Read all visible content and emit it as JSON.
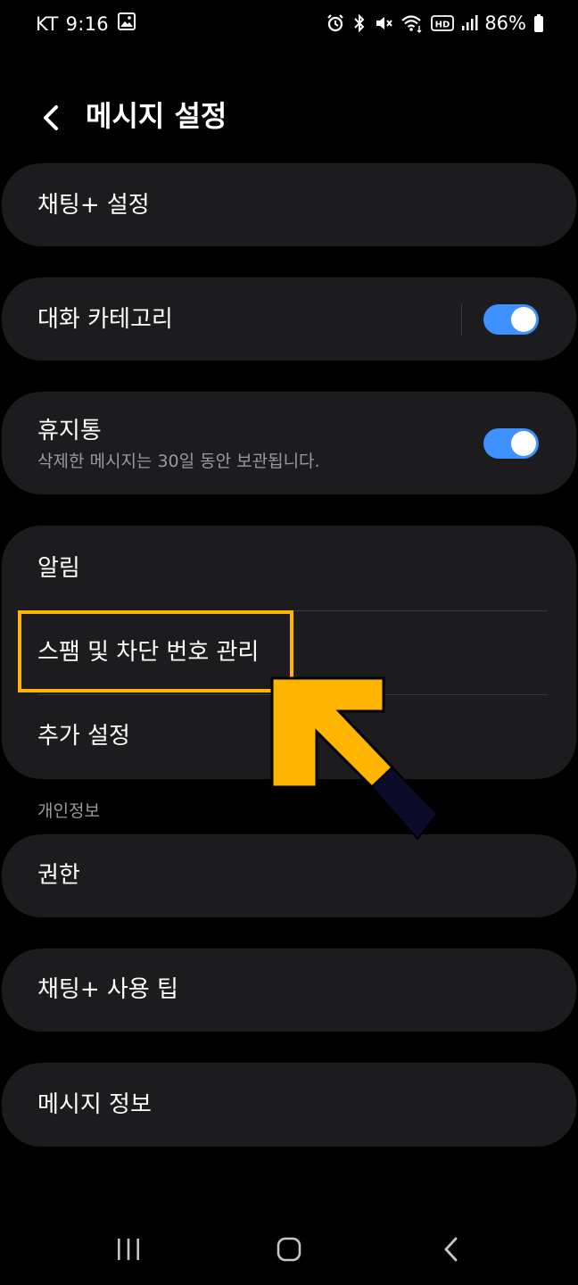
{
  "status_bar": {
    "carrier": "KT",
    "time": "9:16",
    "battery": "86%",
    "icons": [
      "gallery-icon",
      "alarm-icon",
      "bluetooth-icon",
      "mute-icon",
      "wifi-icon",
      "hd-icon",
      "signal-icon",
      "battery-icon"
    ]
  },
  "header": {
    "title": "메시지 설정",
    "back_icon": "chevron-left-icon"
  },
  "settings": {
    "chat_plus_settings": "채팅+ 설정",
    "conversation_categories": {
      "label": "대화 카테고리",
      "enabled": true
    },
    "trash": {
      "label": "휴지통",
      "subtitle": "삭제한 메시지는 30일 동안 보관됩니다.",
      "enabled": true
    },
    "notifications": "알림",
    "spam_block": "스팸 및 차단 번호 관리",
    "more_settings": "추가 설정",
    "privacy_header": "개인정보",
    "permissions": "권한",
    "chat_plus_tips": "채팅+ 사용 팁",
    "about_messages": "메시지 정보"
  },
  "annotation": {
    "highlight_color": "#ffb400",
    "arrow_color": "#ffb400"
  },
  "nav_bar": {
    "recents_icon": "recents-icon",
    "home_icon": "home-icon",
    "back_icon": "back-icon"
  },
  "colors": {
    "background": "#000000",
    "card": "#1c1c1e",
    "toggle_on": "#3e91ff",
    "subtext": "#9a9a9c"
  }
}
